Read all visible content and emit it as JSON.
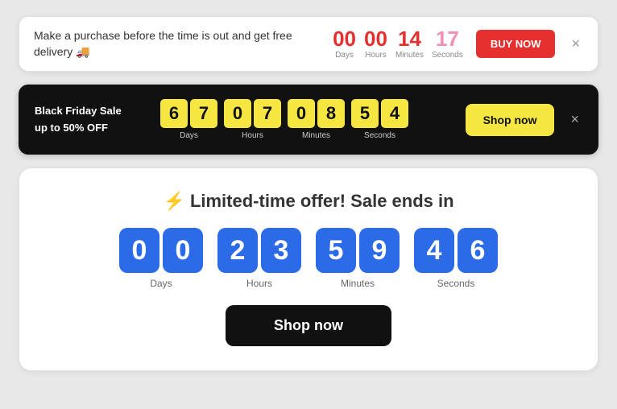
{
  "banner1": {
    "text": "Make a purchase before the time is out and get free delivery 🚚",
    "countdown": {
      "days": {
        "value": "00",
        "label": "Days"
      },
      "hours": {
        "value": "00",
        "label": "Hours"
      },
      "minutes": {
        "value": "14",
        "label": "Minutes"
      },
      "seconds": {
        "value": "17",
        "label": "Seconds"
      }
    },
    "buy_label": "BUY NOW",
    "close_icon": "×"
  },
  "banner2": {
    "title_line1": "Black Friday Sale",
    "title_line2": "up to 50% OFF",
    "countdown": {
      "days": {
        "d1": "6",
        "d2": "7",
        "label": "Days"
      },
      "hours": {
        "d1": "0",
        "d2": "7",
        "label": "Hours"
      },
      "minutes": {
        "d1": "0",
        "d2": "8",
        "label": "Minutes"
      },
      "seconds": {
        "d1": "5",
        "d2": "4",
        "label": "Seconds"
      }
    },
    "shop_label": "Shop now",
    "close_icon": "×"
  },
  "banner3": {
    "title": "⚡ Limited-time offer! Sale ends in",
    "countdown": {
      "days": {
        "d1": "0",
        "d2": "0",
        "label": "Days"
      },
      "hours": {
        "d1": "2",
        "d2": "3",
        "label": "Hours"
      },
      "minutes": {
        "d1": "5",
        "d2": "9",
        "label": "Minutes"
      },
      "seconds": {
        "d1": "4",
        "d2": "6",
        "label": "Seconds"
      }
    },
    "shop_label": "Shop now"
  }
}
